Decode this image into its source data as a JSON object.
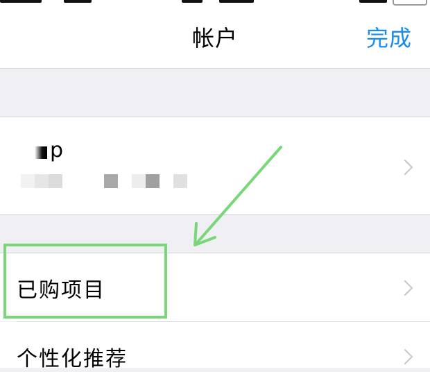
{
  "nav": {
    "title": "帐户",
    "done_label": "完成"
  },
  "account": {
    "name": "p"
  },
  "rows": [
    {
      "label": "已购项目"
    },
    {
      "label": "个性化推荐"
    }
  ],
  "colors": {
    "accent": "#1a8cf0",
    "annotation": "#79d679",
    "group_bg": "#efeff4"
  },
  "icons": [
    "chevron-right-icon",
    "annotation-arrow-icon"
  ]
}
